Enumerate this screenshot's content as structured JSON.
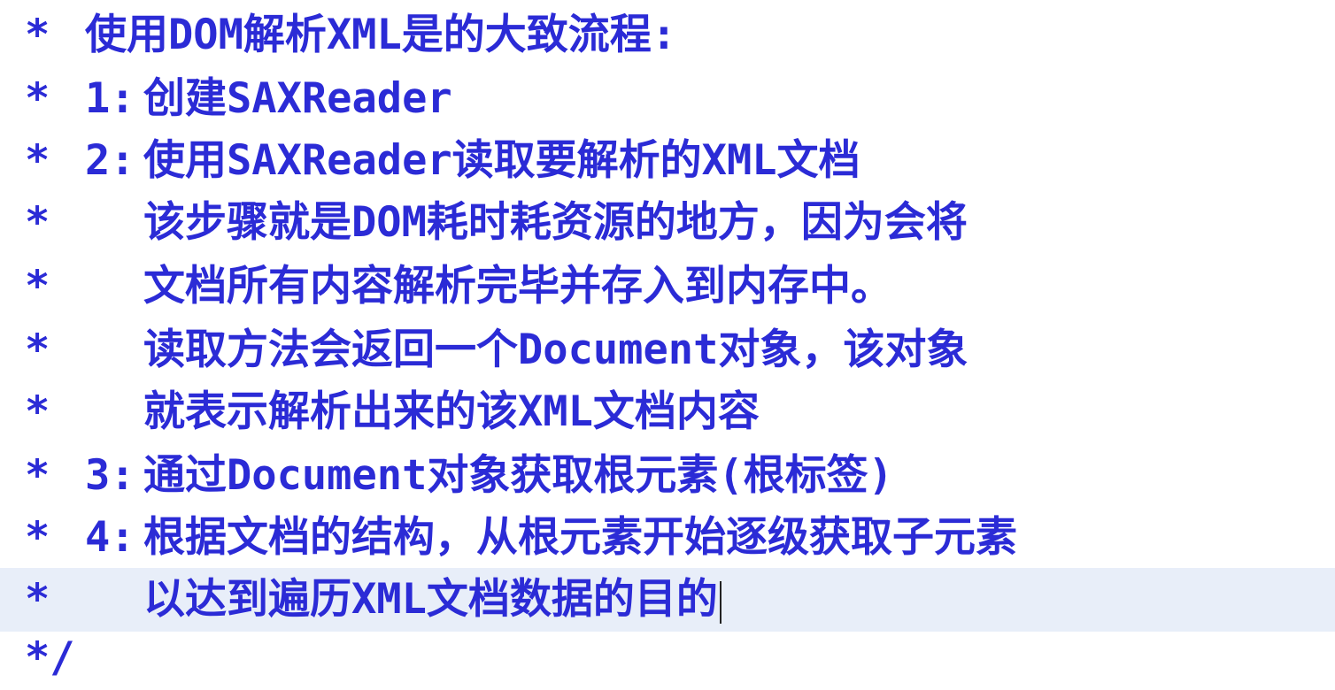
{
  "comment_block": {
    "lines": [
      {
        "prefix": "*",
        "number": "",
        "text": "使用DOM解析XML是的大致流程:"
      },
      {
        "prefix": "*",
        "number": "1:",
        "text": "创建SAXReader"
      },
      {
        "prefix": "*",
        "number": "2:",
        "text": "使用SAXReader读取要解析的XML文档"
      },
      {
        "prefix": "*",
        "number": "",
        "text": "该步骤就是DOM耗时耗资源的地方，因为会将"
      },
      {
        "prefix": "*",
        "number": "",
        "text": "文档所有内容解析完毕并存入到内存中。"
      },
      {
        "prefix": "*",
        "number": "",
        "text": "读取方法会返回一个Document对象，该对象"
      },
      {
        "prefix": "*",
        "number": "",
        "text": "就表示解析出来的该XML文档内容"
      },
      {
        "prefix": "*",
        "number": "3:",
        "text": "通过Document对象获取根元素(根标签)"
      },
      {
        "prefix": "*",
        "number": "4:",
        "text": "根据文档的结构，从根元素开始逐级获取子元素"
      },
      {
        "prefix": "*",
        "number": "",
        "text": "以达到遍历XML文档数据的目的"
      },
      {
        "prefix": "*/",
        "number": "",
        "text": ""
      }
    ]
  },
  "colors": {
    "text": "#2b2bd6",
    "current_line": "#e8eef9",
    "background": "#ffffff"
  }
}
